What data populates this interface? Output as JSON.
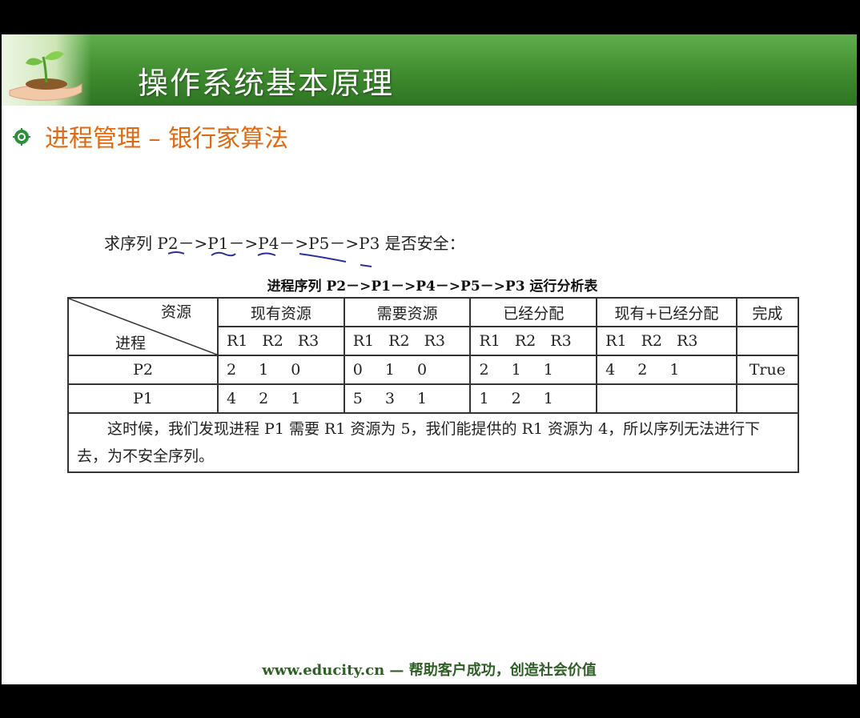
{
  "slide": {
    "title": "操作系统基本原理",
    "heading": "进程管理 – 银行家算法",
    "question": "求序列 P2－>P1－>P4－>P5－>P3 是否安全：",
    "table_caption": "进程序列 P2－>P1－>P4－>P5－>P3 运行分析表",
    "footer": "www.educity.cn — 帮助客户成功，创造社会价值"
  },
  "table": {
    "corner_resource": "资源",
    "corner_process": "进程",
    "headers": [
      "现有资源",
      "需要资源",
      "已经分配",
      "现有+已经分配",
      "完成"
    ],
    "subheaders": [
      "R1 R2 R3",
      "R1 R2 R3",
      "R1 R2 R3",
      "R1 R2 R3",
      ""
    ],
    "rows": [
      {
        "process": "P2",
        "cells": [
          "2 1 0",
          "0 1 0",
          "2 1 1",
          "4 2 1",
          "True"
        ]
      },
      {
        "process": "P1",
        "cells": [
          "4 2 1",
          "5 3 1",
          "1 2 1",
          "",
          ""
        ]
      }
    ],
    "conclusion": "这时候，我们发现进程 P1 需要 R1 资源为 5，我们能提供的 R1 资源为 4，所以序列无法进行下去，为不安全序列。"
  },
  "colors": {
    "banner_green": "#3f8c2f",
    "heading_orange": "#e06a12",
    "footer_green": "#2f5f26",
    "scribble_blue": "#2b2f9e"
  },
  "icons": {
    "banner": "hands-holding-sprout-icon",
    "bullet": "gear-bullet-icon"
  }
}
